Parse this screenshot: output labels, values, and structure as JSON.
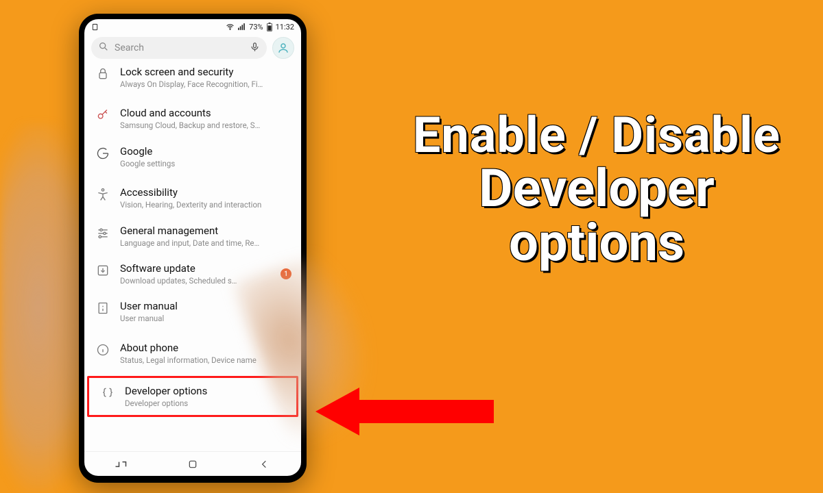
{
  "statusbar": {
    "battery": "73%",
    "time": "11:32"
  },
  "search": {
    "placeholder": "Search"
  },
  "settings": {
    "lock": {
      "title": "Lock screen and security",
      "sub": "Always On Display, Face Recognition, Fi…"
    },
    "cloud": {
      "title": "Cloud and accounts",
      "sub": "Samsung Cloud, Backup and restore, S…"
    },
    "google": {
      "title": "Google",
      "sub": "Google settings"
    },
    "access": {
      "title": "Accessibility",
      "sub": "Vision, Hearing, Dexterity and interaction"
    },
    "general": {
      "title": "General management",
      "sub": "Language and input, Date and time, Re…"
    },
    "software": {
      "title": "Software update",
      "sub": "Download updates, Scheduled s…",
      "badge": "1"
    },
    "manual": {
      "title": "User manual",
      "sub": "User manual"
    },
    "about": {
      "title": "About phone",
      "sub": "Status, Legal information, Device name"
    },
    "dev": {
      "title": "Developer options",
      "sub": "Developer options"
    }
  },
  "overlay": {
    "line1": "Enable / Disable",
    "line2": "Developer",
    "line3": "options"
  }
}
